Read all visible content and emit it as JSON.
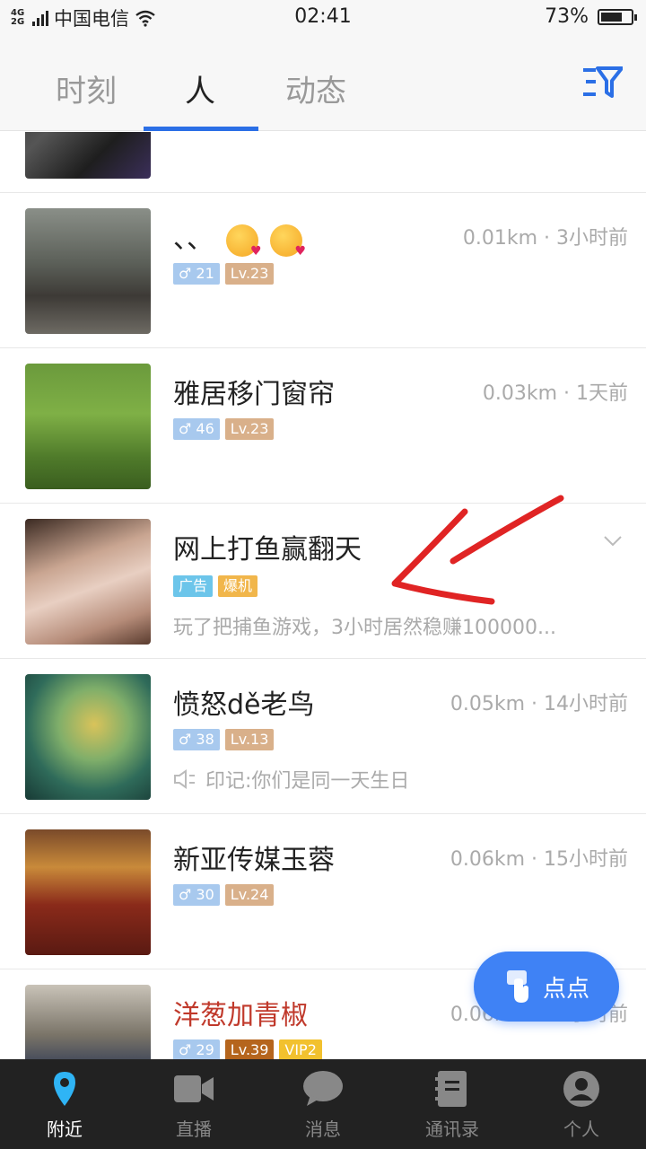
{
  "status_bar": {
    "network": "4G 2G",
    "carrier": "中国电信",
    "time": "02:41",
    "battery": "73%",
    "battery_level": 0.73
  },
  "tabs": [
    {
      "label": "时刻",
      "active": false
    },
    {
      "label": "人",
      "active": true
    },
    {
      "label": "动态",
      "active": false
    }
  ],
  "list": [
    {
      "name": "、、",
      "emojis": [
        "kissing-heart-emoji",
        "kissing-heart-emoji"
      ],
      "meta": "0.01km · 3小时前",
      "gender": "♂ 21",
      "level": "Lv.23"
    },
    {
      "name": "雅居移门窗帘",
      "meta": "0.03km · 1天前",
      "gender": "♂ 46",
      "level": "Lv.23"
    },
    {
      "name": "网上打鱼赢翻天",
      "ad_label": "广告",
      "hot_label": "爆机",
      "desc": "玩了把捕鱼游戏，3小时居然稳赚100000..."
    },
    {
      "name": "愤怒dě老鸟",
      "meta": "0.05km · 14小时前",
      "gender": "♂ 38",
      "level": "Lv.13",
      "imprint": "印记:你们是同一天生日"
    },
    {
      "name": "新亚传媒玉蓉",
      "meta": "0.06km · 15小时前",
      "gender": "♂ 30",
      "level": "Lv.24"
    },
    {
      "name": "洋葱加青椒",
      "meta": "0.06km · 17小时前",
      "gender": "♂ 29",
      "level": "Lv.39",
      "vip": "VIP2"
    }
  ],
  "fab": {
    "label": "点点"
  },
  "bottom_nav": [
    {
      "label": "附近",
      "icon": "location-pin-icon",
      "active": true
    },
    {
      "label": "直播",
      "icon": "video-camera-icon",
      "active": false
    },
    {
      "label": "消息",
      "icon": "chat-bubble-icon",
      "active": false
    },
    {
      "label": "通讯录",
      "icon": "contacts-book-icon",
      "active": false
    },
    {
      "label": "个人",
      "icon": "user-avatar-icon",
      "active": false
    }
  ],
  "colors": {
    "accent": "#2b6fe6",
    "fab": "#3f82f5",
    "nav_bg": "#222222",
    "annotation": "#e02424"
  }
}
